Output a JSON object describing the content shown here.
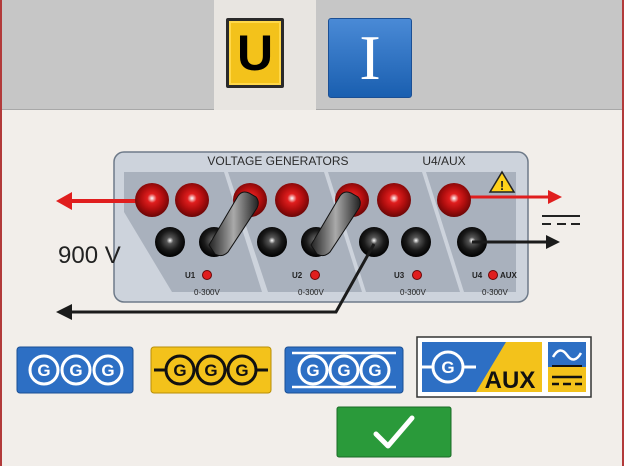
{
  "modes": {
    "voltage_label": "U",
    "current_label": "I"
  },
  "panel": {
    "title": "VOLTAGE GENERATORS",
    "aux_title": "U4/AUX",
    "output_voltage": "900 V",
    "channels": [
      {
        "label": "U1",
        "range": "0-300V"
      },
      {
        "label": "U2",
        "range": "0-300V"
      },
      {
        "label": "U3",
        "range": "0-300V"
      },
      {
        "label": "U4",
        "range": "0-300V",
        "extra": "AUX"
      }
    ]
  },
  "configs": [
    {
      "id": "config-1",
      "letter": "G",
      "count": 3,
      "style": "separate",
      "color": "#2d6fc4",
      "selected": false
    },
    {
      "id": "config-2",
      "letter": "G",
      "count": 3,
      "style": "series",
      "color": "#f3c21b",
      "selected": true
    },
    {
      "id": "config-3",
      "letter": "G",
      "count": 3,
      "style": "parallel",
      "color": "#2d6fc4",
      "selected": false
    }
  ],
  "aux_option": {
    "letter": "G",
    "label": "AUX"
  },
  "icons": [
    "warning-icon",
    "dc-symbol-icon",
    "ac-dc-icon",
    "checkmark-icon"
  ],
  "colors": {
    "accent_yellow": "#f3c21b",
    "accent_blue": "#2d6fc4",
    "ok_green": "#2a9a3a",
    "lead_red": "#e01e1e"
  }
}
